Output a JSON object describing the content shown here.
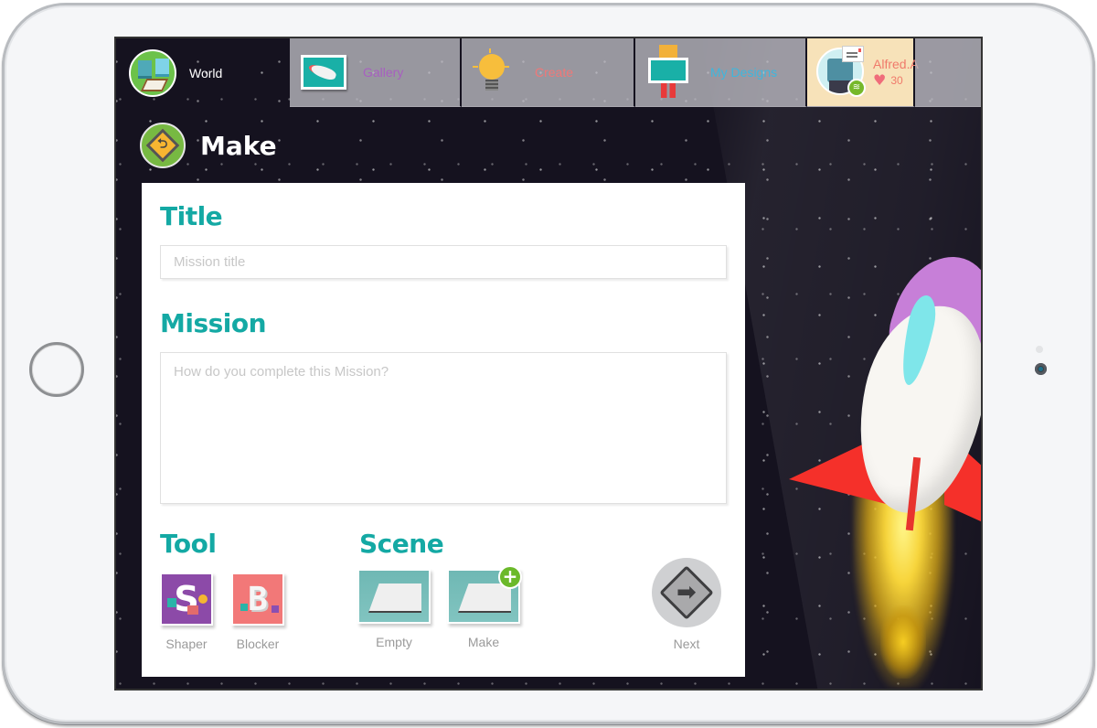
{
  "nav": {
    "world": {
      "label": "World",
      "icon": "world-map-icon"
    },
    "tabs": [
      {
        "id": "gallery",
        "label": "Gallery",
        "icon": "gallery-frame-icon",
        "color": "#a85fc0"
      },
      {
        "id": "create",
        "label": "Create",
        "icon": "lightbulb-icon",
        "color": "#f07878"
      },
      {
        "id": "my-designs",
        "label": "My Designs",
        "icon": "robot-designs-icon",
        "color": "#3fb6dd"
      }
    ],
    "profile": {
      "username": "Alfred.A",
      "likes": "30",
      "heart_glyph": "♥",
      "wifi_glyph": "≋"
    }
  },
  "page": {
    "title": "Make",
    "back_glyph": "⮌"
  },
  "form": {
    "title_heading": "Title",
    "title_placeholder": "Mission title",
    "title_value": "",
    "mission_heading": "Mission",
    "mission_placeholder": "How do you complete this Mission?",
    "mission_value": "",
    "tool_heading": "Tool",
    "tools": [
      {
        "label": "Shaper",
        "glyph": "S"
      },
      {
        "label": "Blocker",
        "glyph": "B"
      }
    ],
    "scene_heading": "Scene",
    "scenes": [
      {
        "label": "Empty"
      },
      {
        "label": "Make",
        "badge": "+"
      }
    ],
    "next_label": "Next",
    "next_glyph": "➡"
  },
  "colors": {
    "accent_teal": "#14a9a4",
    "background_space": "#15121f",
    "profile_tab": "#f7e2b9"
  }
}
